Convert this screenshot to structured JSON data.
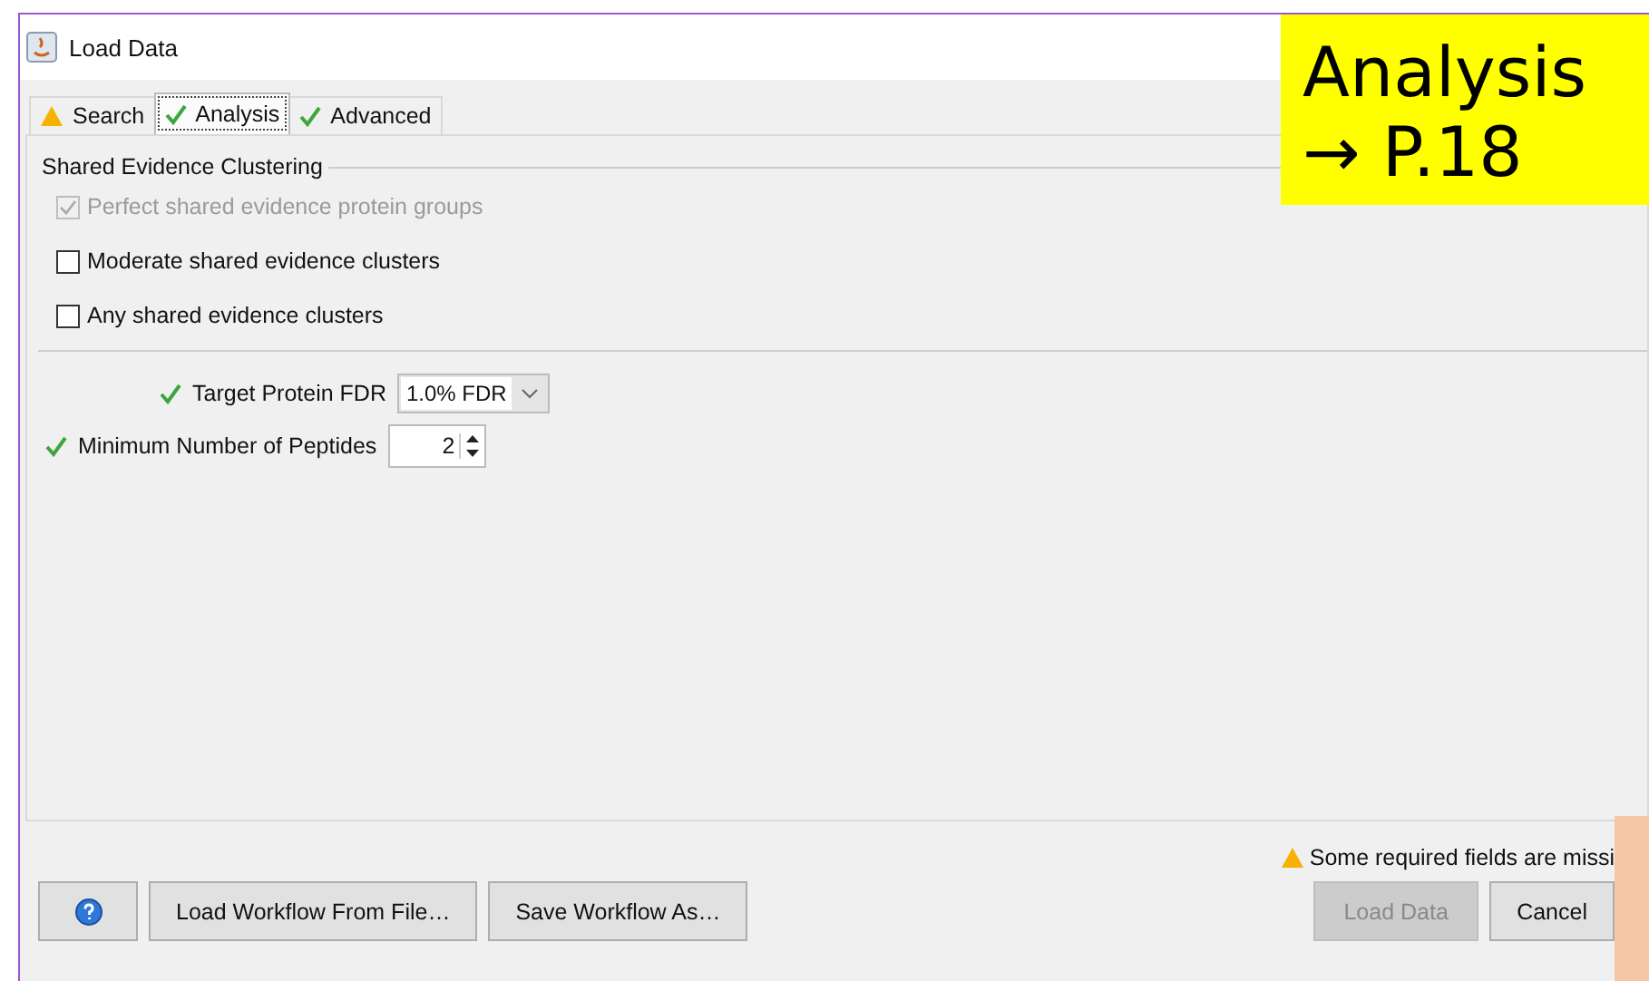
{
  "window": {
    "title": "Load Data"
  },
  "tabs": [
    {
      "label": "Search",
      "kind": "warning",
      "selected": false
    },
    {
      "label": "Analysis",
      "kind": "ok",
      "selected": true
    },
    {
      "label": "Advanced",
      "kind": "ok",
      "selected": false
    }
  ],
  "group": {
    "title": "Shared Evidence Clustering"
  },
  "options": [
    {
      "label": "Perfect shared evidence protein groups",
      "checked": true,
      "disabled": true
    },
    {
      "label": "Moderate shared evidence clusters",
      "checked": false,
      "disabled": false
    },
    {
      "label": "Any shared evidence clusters",
      "checked": false,
      "disabled": false
    }
  ],
  "settings": [
    {
      "kind": "dropdown",
      "label": "Target Protein FDR",
      "value": "1.0% FDR"
    },
    {
      "kind": "spinner",
      "label": "Minimum Number of Peptides",
      "value": "2"
    }
  ],
  "status_message": {
    "kind": "warning",
    "text": "Some required fields are missi"
  },
  "footer_left": [
    "Load Workflow From File…",
    "Save Workflow As…"
  ],
  "footer_right": [
    {
      "label": "Load Data",
      "disabled": true
    },
    {
      "label": "Cancel",
      "disabled": false
    }
  ],
  "callout": {
    "lines": [
      "Analysis",
      "→ P.18"
    ]
  }
}
